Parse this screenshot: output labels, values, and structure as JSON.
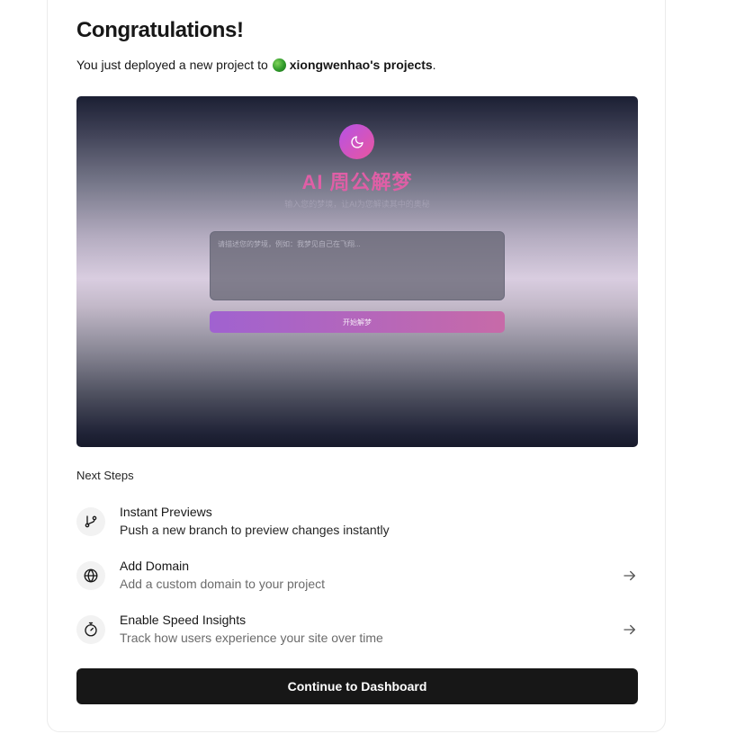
{
  "header": {
    "title": "Congratulations!",
    "subtitle_prefix": "You just deployed a new project to",
    "team_name": "xiongwenhao's projects",
    "subtitle_suffix": "."
  },
  "preview": {
    "app_title": "AI 周公解梦",
    "app_subtitle": "输入您的梦境，让AI为您解读其中的奥秘",
    "input_placeholder": "请描述您的梦境，例如：我梦见自己在飞翔...",
    "button_label": "开始解梦",
    "icon": "moon-icon"
  },
  "next_steps": {
    "label": "Next Steps",
    "items": [
      {
        "title": "Instant Previews",
        "description": "Push a new branch to preview changes instantly",
        "icon": "git-branch-icon"
      },
      {
        "title": "Add Domain",
        "description": "Add a custom domain to your project",
        "icon": "globe-icon"
      },
      {
        "title": "Enable Speed Insights",
        "description": "Track how users experience your site over time",
        "icon": "speed-insights-icon"
      }
    ]
  },
  "actions": {
    "continue_label": "Continue to Dashboard"
  },
  "colors": {
    "primary_button": "#171717",
    "preview_accent": "#df5fa6",
    "team_avatar": "#2f9a2a"
  }
}
